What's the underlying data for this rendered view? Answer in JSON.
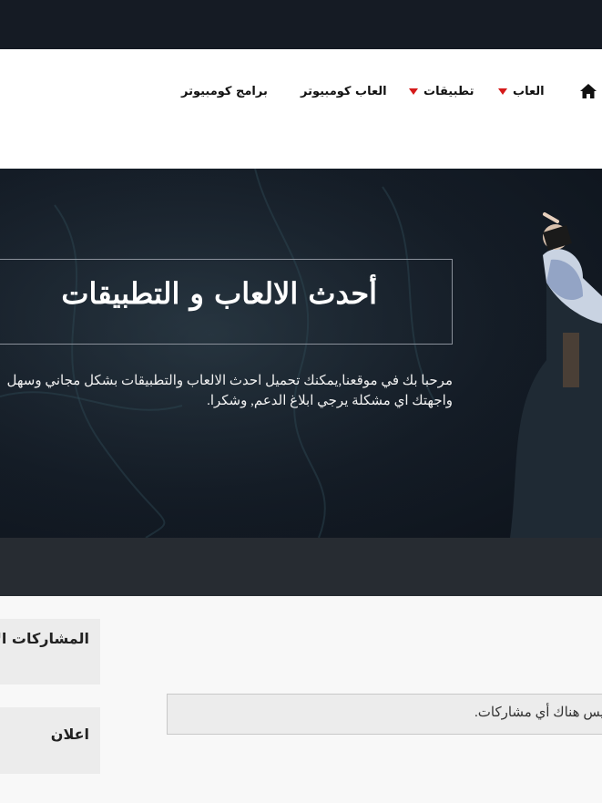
{
  "nav": {
    "home_icon": "home-icon",
    "items": [
      {
        "label": "العاب",
        "has_dropdown": true
      },
      {
        "label": "تطبيقات",
        "has_dropdown": true
      },
      {
        "label": "العاب كومبيوتر",
        "has_dropdown": false
      },
      {
        "label": "برامج كومبيوتر",
        "has_dropdown": false
      }
    ],
    "caret_color": "#d51a1a"
  },
  "hero": {
    "title": "أحدث الالعاب و التطبيقات",
    "description_line1": "مرحبا بك في موقعنا,يمكنك تحميل احدث الالعاب والتطبيقات بشكل مجاني وسهل",
    "description_line2": "واجهتك اي مشكلة يرجي ابلاغ الدعم, وشكرا."
  },
  "sidebar": {
    "recent_posts_title": "المشاركات الأخيرة",
    "ads_title": "اعلان"
  },
  "main": {
    "no_posts_message": "ليس هناك أي مشاركات."
  },
  "colors": {
    "topbar": "#151b24",
    "band": "#272c32",
    "accent": "#d51a1a"
  }
}
